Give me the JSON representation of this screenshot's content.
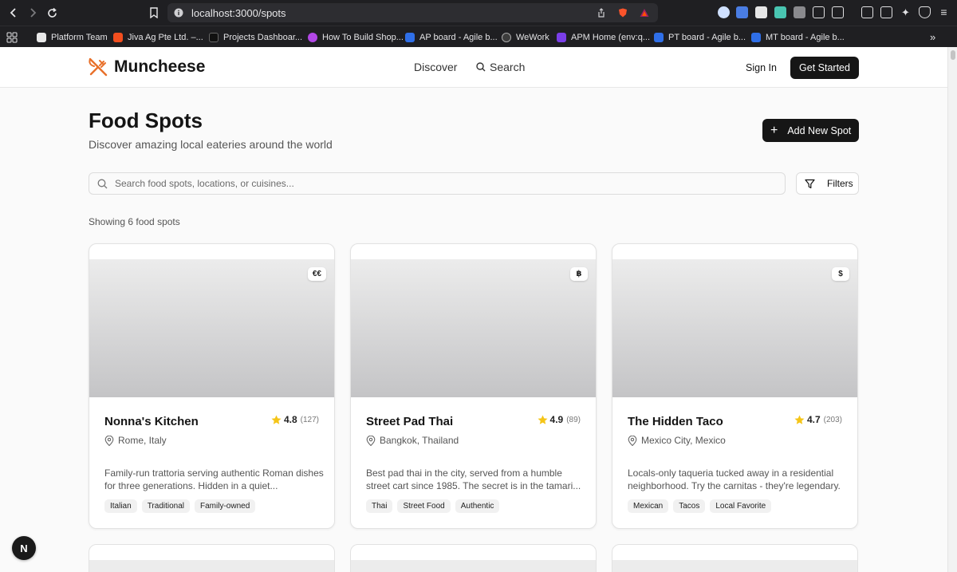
{
  "browser": {
    "url": "localhost:3000/spots",
    "bookmarks": [
      {
        "label": "Platform Team",
        "color": "#e8e8e8"
      },
      {
        "label": "Jiva Ag Pte Ltd. –...",
        "color": "#f24e1e"
      },
      {
        "label": "Projects Dashboar...",
        "color": "#111111"
      },
      {
        "label": "How To Build Shop...",
        "color": "#b247e6"
      },
      {
        "label": "AP board - Agile b...",
        "color": "#2f6fe8"
      },
      {
        "label": "WeWork",
        "color": "#3c3c3c"
      },
      {
        "label": "APM Home (env:q...",
        "color": "#7a3ee8"
      },
      {
        "label": "PT board - Agile b...",
        "color": "#2f6fe8"
      },
      {
        "label": "MT board - Agile b...",
        "color": "#2f6fe8"
      }
    ]
  },
  "header": {
    "brand": "Muncheese",
    "nav": [
      "Discover",
      "Search"
    ],
    "sign_in": "Sign In",
    "get_started": "Get Started",
    "accent": "#e8702a"
  },
  "main": {
    "title": "Food Spots",
    "subtitle": "Discover amazing local eateries around the world",
    "add_button": "Add New Spot",
    "search_placeholder": "Search food spots, locations, or cuisines...",
    "filters": "Filters",
    "showing": "Showing 6 food spots"
  },
  "spots": [
    {
      "name": "Nonna's Kitchen",
      "price": "€€",
      "rating": "4.8",
      "reviews": "(127)",
      "location": "Rome, Italy",
      "description": "Family-run trattoria serving authentic Roman dishes for three generations. Hidden in a quiet...",
      "tags": [
        "Italian",
        "Traditional",
        "Family-owned"
      ]
    },
    {
      "name": "Street Pad Thai",
      "price": "฿",
      "rating": "4.9",
      "reviews": "(89)",
      "location": "Bangkok, Thailand",
      "description": "Best pad thai in the city, served from a humble street cart since 1985. The secret is in the tamari...",
      "tags": [
        "Thai",
        "Street Food",
        "Authentic"
      ]
    },
    {
      "name": "The Hidden Taco",
      "price": "$",
      "rating": "4.7",
      "reviews": "(203)",
      "location": "Mexico City, Mexico",
      "description": "Locals-only taqueria tucked away in a residential neighborhood. Try the carnitas - they're legendary.",
      "tags": [
        "Mexican",
        "Tacos",
        "Local Favorite"
      ]
    }
  ],
  "dev_badge": "N"
}
